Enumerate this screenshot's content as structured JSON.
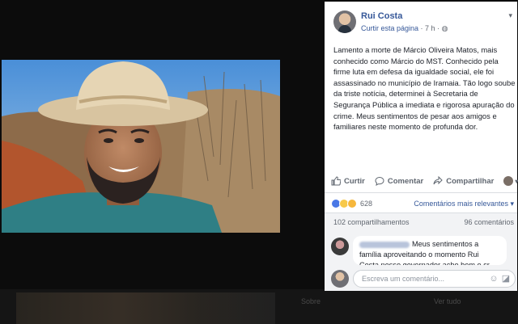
{
  "post": {
    "page_name": "Rui Costa",
    "like_page": "Curtir esta página",
    "separator": " · ",
    "time": "7 h",
    "dot": " · ",
    "text": "Lamento a morte de Márcio Oliveira Matos, mais conhecido como Márcio do MST. Conhecido pela firme luta em defesa da igualdade social, ele foi assassinado no município de Iramaia. Tão logo soube da triste notícia, determinei à Secretaria de Segurança Pública a imediata e rigorosa apuração do crime. Meus sentimentos de pesar aos amigos e familiares neste momento de profunda dor."
  },
  "actions": {
    "like": "Curtir",
    "comment": "Comentar",
    "share": "Compartilhar"
  },
  "reactions": {
    "count": "628",
    "sort_label": "Comentários mais relevantes ▾"
  },
  "stats": {
    "shares": "102 compartilhamentos",
    "comments": "96 comentários"
  },
  "comment": {
    "text": "Meus sentimentos a família aproveitando o momento Rui Costa nosso governador acho bom o sr averiguar a"
  },
  "composer": {
    "placeholder": "Escreva um comentário..."
  },
  "background": {
    "label_a": "Sobre",
    "label_b": "Ver tudo"
  },
  "colors": {
    "link": "#365899",
    "text": "#1d2129",
    "muted": "#616770"
  }
}
